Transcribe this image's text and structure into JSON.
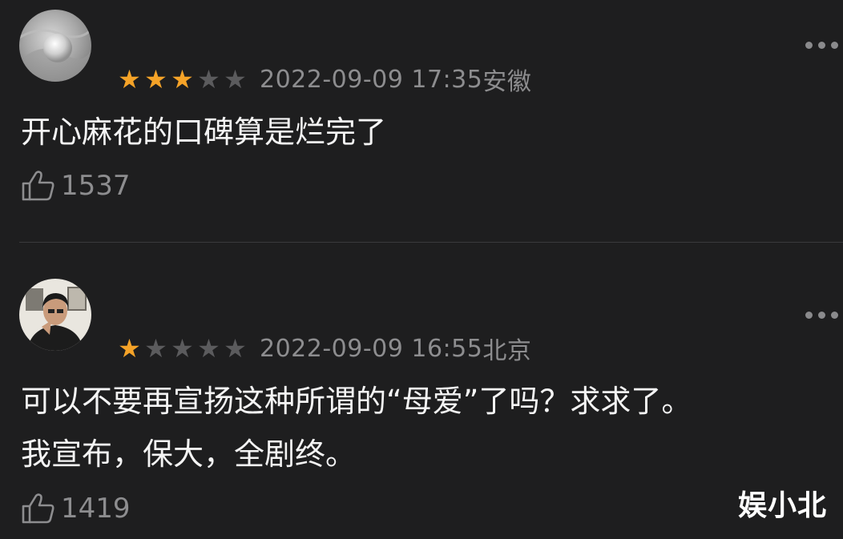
{
  "comments": [
    {
      "rating_stars": 3,
      "date": "2022-09-09 17:35",
      "location": "安徽",
      "text": "开心麻花的口碑算是烂完了",
      "likes": "1537",
      "avatar_icon": "avatar-pearl-icon"
    },
    {
      "rating_stars": 1,
      "date": "2022-09-09 16:55",
      "location": "北京",
      "text": "可以不要再宣扬这种所谓的“母爱”了吗？求求了。\n我宣布，保大，全剧终。",
      "likes": "1419",
      "avatar_icon": "avatar-person-icon"
    }
  ],
  "colors": {
    "background": "#1e1e1f",
    "star_on": "#f5a328",
    "star_off": "#5b5b5d",
    "meta_text": "#8d8d8f"
  },
  "watermark": "娱小北"
}
